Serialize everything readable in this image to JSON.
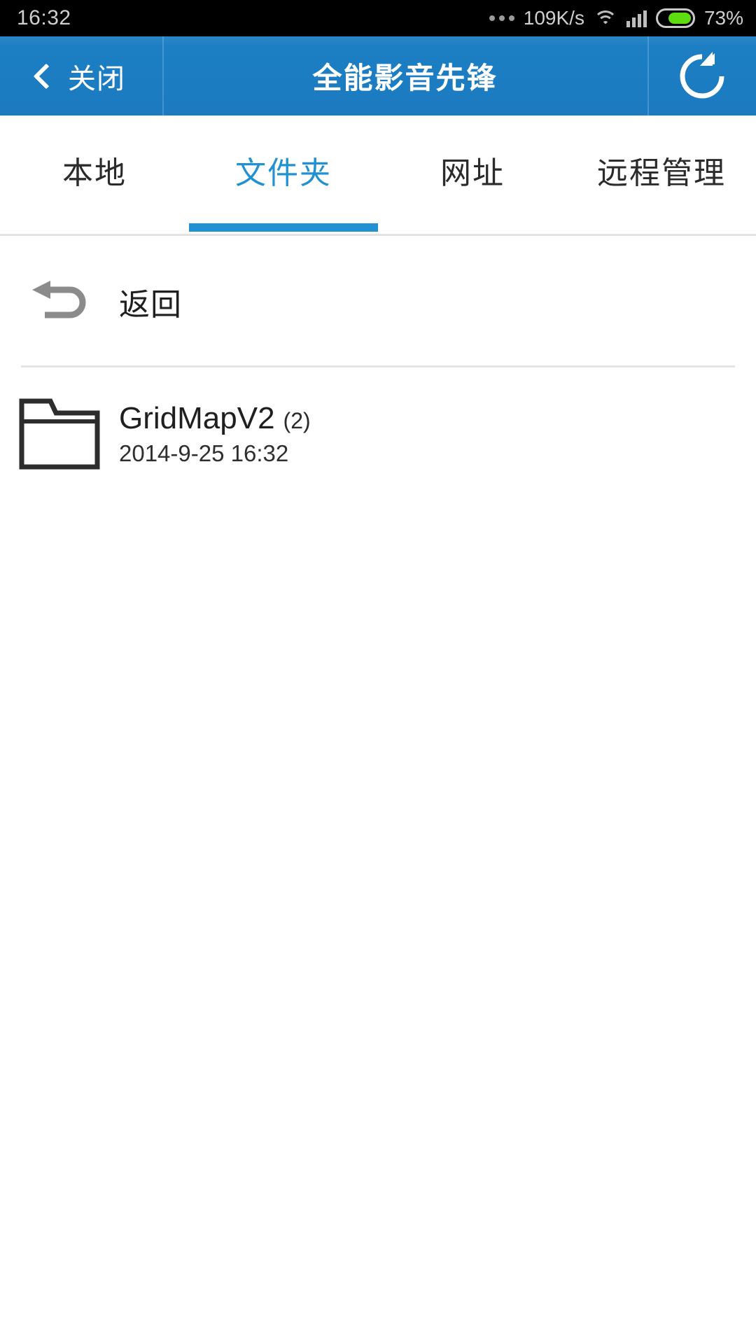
{
  "status_bar": {
    "time": "16:32",
    "network_speed": "109K/s",
    "battery_percent": "73%",
    "battery_level": 73,
    "icons": [
      "more-dots-icon",
      "wifi-icon",
      "cellular-signal-icon",
      "battery-icon"
    ]
  },
  "header": {
    "close_label": "关闭",
    "back_icon": "chevron-left-icon",
    "title": "全能影音先锋",
    "refresh_icon": "refresh-icon",
    "background_color": "#1b7ac0"
  },
  "tabs": {
    "active_index": 1,
    "accent_color": "#2291d1",
    "items": [
      {
        "label": "本地"
      },
      {
        "label": "文件夹"
      },
      {
        "label": "网址"
      },
      {
        "label": "远程管理"
      }
    ]
  },
  "file_browser": {
    "back_row": {
      "icon": "return-arrow-icon",
      "label": "返回"
    },
    "entries": [
      {
        "icon": "folder-icon",
        "name": "GridMapV2",
        "count": "(2)",
        "date": "2014-9-25 16:32"
      }
    ]
  }
}
